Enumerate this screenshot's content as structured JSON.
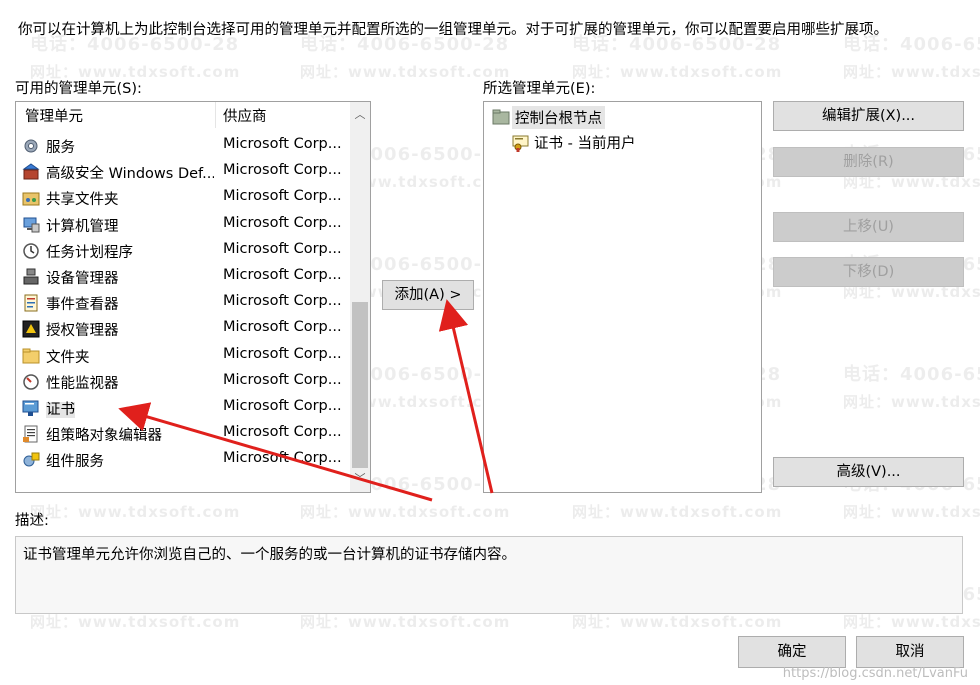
{
  "intro_text": "你可以在计算机上为此控制台选择可用的管理单元并配置所选的一组管理单元。对于可扩展的管理单元，你可以配置要启用哪些扩展项。",
  "available": {
    "label": "可用的管理单元(S):",
    "col_name": "管理单元",
    "col_vendor": "供应商",
    "rows": [
      {
        "name": "服务",
        "vendor": "Microsoft Corp...",
        "icon": "gear-icon"
      },
      {
        "name": "高级安全 Windows Def...",
        "vendor": "Microsoft Corp...",
        "icon": "firewall-icon"
      },
      {
        "name": "共享文件夹",
        "vendor": "Microsoft Corp...",
        "icon": "shared-folder-icon"
      },
      {
        "name": "计算机管理",
        "vendor": "Microsoft Corp...",
        "icon": "computer-management-icon"
      },
      {
        "name": "任务计划程序",
        "vendor": "Microsoft Corp...",
        "icon": "clock-icon"
      },
      {
        "name": "设备管理器",
        "vendor": "Microsoft Corp...",
        "icon": "device-manager-icon"
      },
      {
        "name": "事件查看器",
        "vendor": "Microsoft Corp...",
        "icon": "event-viewer-icon"
      },
      {
        "name": "授权管理器",
        "vendor": "Microsoft Corp...",
        "icon": "authorization-icon"
      },
      {
        "name": "文件夹",
        "vendor": "Microsoft Corp...",
        "icon": "folder-icon"
      },
      {
        "name": "性能监视器",
        "vendor": "Microsoft Corp...",
        "icon": "performance-icon"
      },
      {
        "name": "证书",
        "vendor": "Microsoft Corp...",
        "icon": "certificate-icon"
      },
      {
        "name": "组策略对象编辑器",
        "vendor": "Microsoft Corp...",
        "icon": "policy-editor-icon"
      },
      {
        "name": "组件服务",
        "vendor": "Microsoft Corp...",
        "icon": "component-services-icon"
      }
    ]
  },
  "add_button": "添加(A) >",
  "selected": {
    "label": "所选管理单元(E):",
    "root": "控制台根节点",
    "child": "证书 - 当前用户"
  },
  "buttons": {
    "edit_ext": "编辑扩展(X)...",
    "remove": "删除(R)",
    "move_up": "上移(U)",
    "move_down": "下移(D)",
    "advanced": "高级(V)...",
    "ok": "确定",
    "cancel": "取消"
  },
  "description": {
    "label": "描述:",
    "text": "证书管理单元允许你浏览自己的、一个服务的或一台计算机的证书存储内容。"
  },
  "watermark": {
    "phone": "电话：4006-6500-28",
    "site": "网址：www.tdxsoft.com"
  },
  "footer_url": "https://blog.csdn.net/LvanFu",
  "colors": {
    "annotation_arrow": "#e0201c",
    "button_face": "#e1e1e1",
    "disabled_text": "#a0a0a0"
  }
}
